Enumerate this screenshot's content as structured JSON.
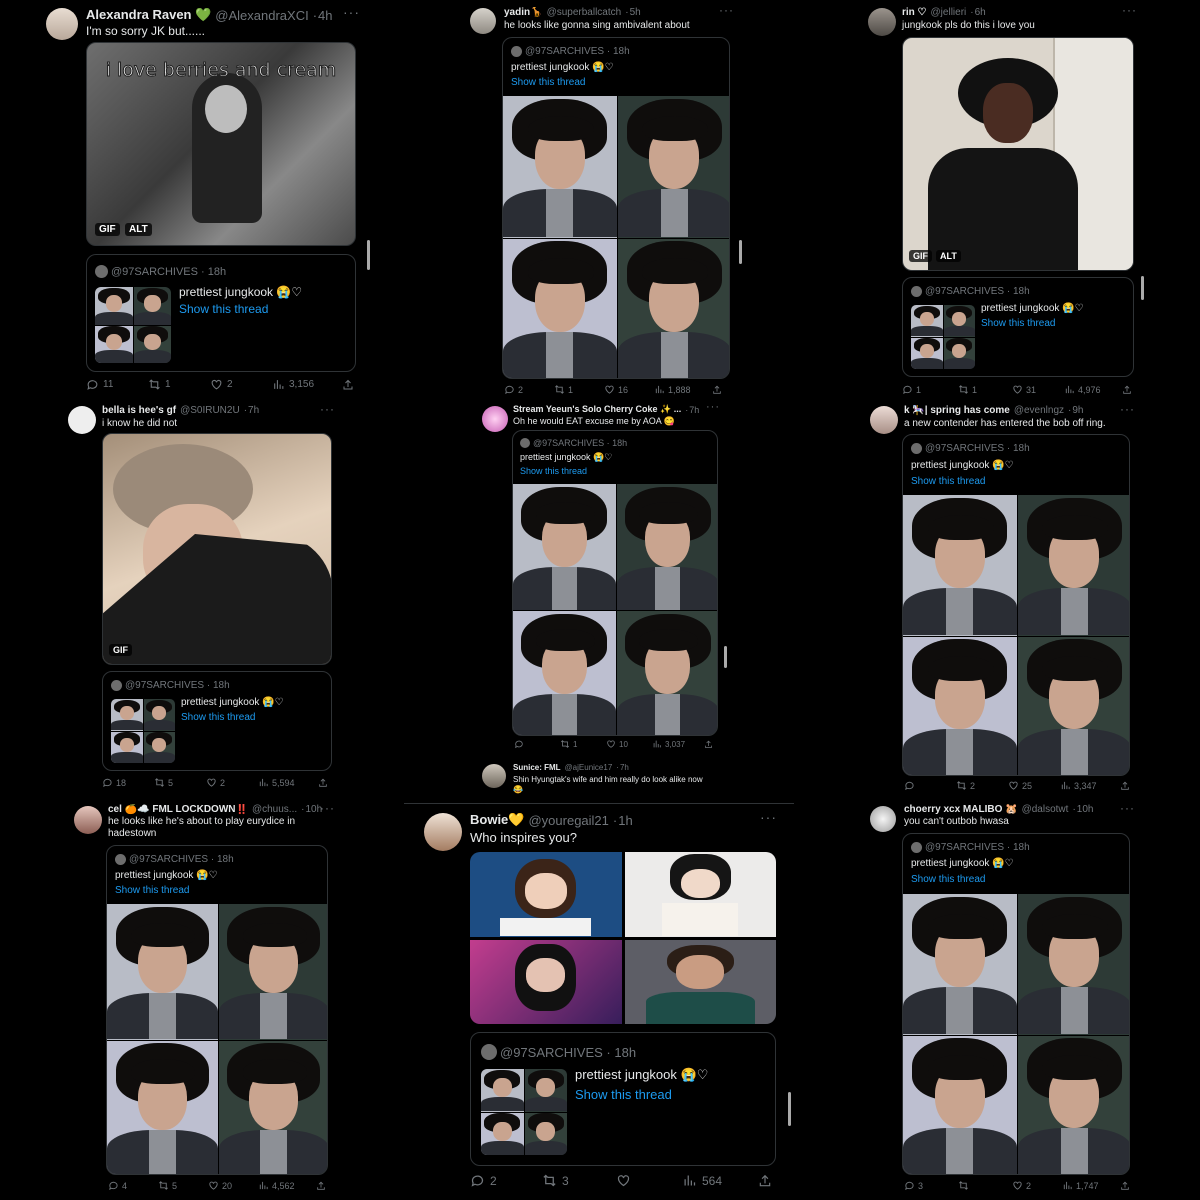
{
  "quote": {
    "handle": "@97SARCHIVES",
    "time": "18h",
    "text": "prettiest jungkook 😭♡",
    "show": "Show this thread"
  },
  "tweets": [
    {
      "name": "Alexandra Raven 💚",
      "handle": "@AlexandraXCI",
      "time": "4h",
      "text": "I'm so sorry JK but......",
      "media_caption": "i love berries and cream",
      "badges": [
        "GIF",
        "ALT"
      ],
      "replies": "11",
      "retweets": "1",
      "likes": "2",
      "views": "3,156"
    },
    {
      "name": "yadin🦒",
      "handle": "@superballcatch",
      "time": "5h",
      "text": "he looks like gonna sing ambivalent about",
      "replies": "2",
      "retweets": "1",
      "likes": "16",
      "views": "1,888"
    },
    {
      "name": "rin ♡",
      "handle": "@jellieri",
      "time": "6h",
      "text": "jungkook pls do this i love you",
      "badges": [
        "GIF",
        "ALT"
      ],
      "replies": "1",
      "retweets": "1",
      "likes": "31",
      "views": "4,976"
    },
    {
      "name": "bella is hee's gf",
      "handle": "@S0IRUN2U",
      "time": "7h",
      "text": "i know he did not",
      "badges": [
        "GIF"
      ],
      "replies": "18",
      "retweets": "5",
      "likes": "2",
      "views": "5,594"
    },
    {
      "name": "Stream Yeeun's Solo Cherry Coke ✨ ...",
      "handle": "",
      "time": "7h",
      "text": "Oh he would EAT excuse me by AOA 😋",
      "replies": "",
      "retweets": "1",
      "likes": "10",
      "views": "3,037"
    },
    {
      "name": "k 🎠| spring has come",
      "handle": "@evenlngz",
      "time": "9h",
      "text": "a new contender has entered the bob off ring.",
      "replies": "",
      "retweets": "2",
      "likes": "25",
      "views": "3,347"
    },
    {
      "name": "cel 🍊☁️ FML LOCKDOWN‼️",
      "handle": "@chuus...",
      "time": "10h",
      "text": "he looks like he's about to play eurydice in hadestown",
      "replies": "4",
      "retweets": "5",
      "likes": "20",
      "views": "4,562"
    },
    {
      "name": "Bowie💛",
      "handle": "@youregail21",
      "time": "1h",
      "text": "Who inspires you?",
      "replies": "2",
      "retweets": "3",
      "likes": "",
      "views": "564"
    },
    {
      "name": "choerry xcx MALIBO 🐹",
      "handle": "@dalsotwt",
      "time": "10h",
      "text": "you can't outbob hwasa",
      "replies": "3",
      "retweets": "",
      "likes": "2",
      "views": "1,747"
    },
    {
      "name": "Sunice: FML",
      "handle": "@ajEunice17",
      "time": "7h",
      "text": "Shin Hyungtak's wife and him really do look alike now 😂"
    }
  ],
  "colors": {
    "link": "#1d9bf0",
    "muted": "#71767b",
    "border": "#2f3336",
    "bg": "#000000"
  }
}
